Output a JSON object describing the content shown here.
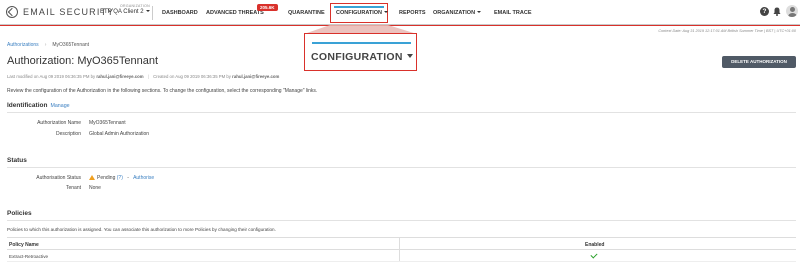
{
  "app": {
    "brand": "EMAIL SECURITY",
    "org_label": "ORGANIZATION",
    "org_value": "ETP QA Client 2"
  },
  "nav": {
    "dashboard": "DASHBOARD",
    "advanced_threats": "ADVANCED THREATS",
    "advanced_threats_badge": "205.6K",
    "quarantine": "QUARANTINE",
    "configuration": "CONFIGURATION",
    "reports": "REPORTS",
    "organization": "ORGANIZATION",
    "email_trace": "EMAIL TRACE",
    "help_glyph": "?"
  },
  "context_date": "Context Date: Aug 31 2019 12:17:01 AM British Summer Time | BST | UTC+01:00",
  "breadcrumb": {
    "root": "Authorizations",
    "current": "MyO365Tennant"
  },
  "page": {
    "title": "Authorization: MyO365Tennant",
    "delete_label": "DELETE AUTHORIZATION",
    "meta_modified_prefix": "Last modified on Aug 09 2019 06:36:35 PM by",
    "meta_modified_by": "rahul.jani@fireeye.com",
    "meta_created_prefix": "Created on Aug 09 2019 06:36:35 PM by",
    "meta_created_by": "rahul.jani@fireeye.com",
    "intro": "Review the configuration of the Authorization in the following sections. To change the configuration, select the corresponding \"Manage\" links."
  },
  "identification": {
    "heading": "Identification",
    "manage": "Manage",
    "name_label": "Authorization Name",
    "name_value": "MyO365Tennant",
    "desc_label": "Description",
    "desc_value": "Global Admin Authorization"
  },
  "status": {
    "heading": "Status",
    "status_label": "Authorisation Status",
    "status_value": "Pending",
    "status_help": "(?)",
    "status_sep": "-",
    "authorise": "Authorise",
    "tenant_label": "Tenant",
    "tenant_value": "None"
  },
  "policies": {
    "heading": "Policies",
    "note": "Policies to which this authorization is assigned. You can associate this authorization to more Policies by changing their configuration.",
    "columns": [
      "Policy Name",
      "Enabled"
    ],
    "rows": [
      {
        "name": "Extract-Retroactive",
        "enabled": true
      }
    ]
  },
  "zoom": {
    "label": "CONFIGURATION"
  },
  "colors": {
    "accent_red": "#d9312b",
    "accent_blue": "#3aa2d6",
    "link": "#3a7fc1",
    "button": "#505a66",
    "success": "#2aa02a",
    "warning": "#f0a020"
  }
}
